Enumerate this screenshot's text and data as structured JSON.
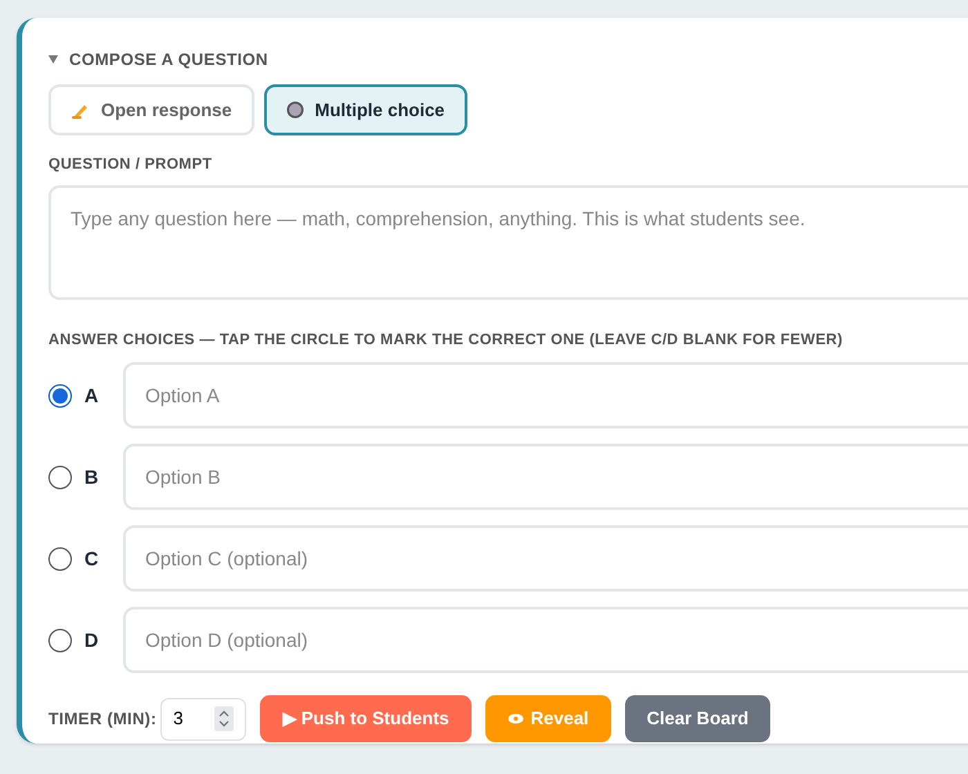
{
  "section": {
    "title": "COMPOSE A QUESTION",
    "expanded": true
  },
  "modes": [
    {
      "kind": "open",
      "label": "Open response",
      "selected": false
    },
    {
      "kind": "choice",
      "label": "Multiple choice",
      "selected": true
    }
  ],
  "prompt": {
    "label": "QUESTION / PROMPT",
    "placeholder": "Type any question here — math, comprehension, anything. This is what students see."
  },
  "answers_label": "ANSWER CHOICES — TAP THE CIRCLE TO MARK THE CORRECT ONE (LEAVE C/D BLANK FOR FEWER)",
  "choices": [
    {
      "letter": "A",
      "placeholder": "Option A",
      "selected": true
    },
    {
      "letter": "B",
      "placeholder": "Option B",
      "selected": false
    },
    {
      "letter": "C",
      "placeholder": "Option C (optional)",
      "selected": false
    },
    {
      "letter": "D",
      "placeholder": "Option D (optional)",
      "selected": false
    }
  ],
  "timer": {
    "label": "TIMER (MIN):",
    "value": "3"
  },
  "actions": [
    {
      "kind": "push",
      "label": "▶ Push to Students"
    },
    {
      "kind": "reveal",
      "label": "Reveal"
    },
    {
      "kind": "clear",
      "label": "Clear Board"
    }
  ]
}
